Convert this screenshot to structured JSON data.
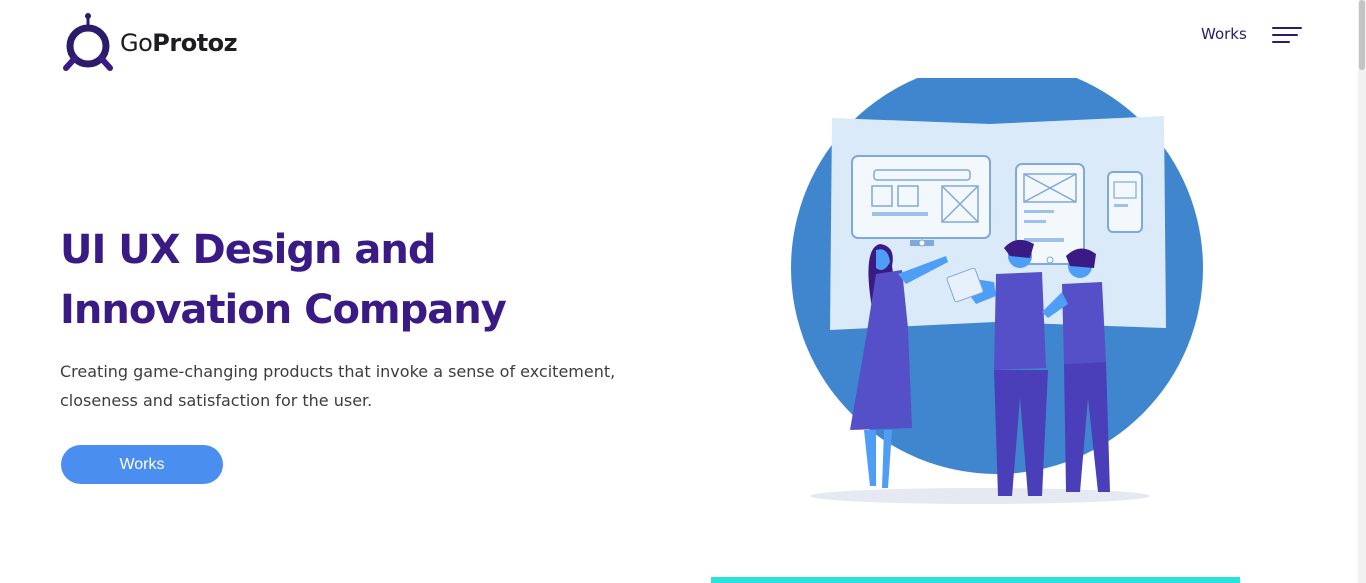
{
  "brand": {
    "prefix": "Go",
    "name": "Protoz"
  },
  "nav": {
    "works_label": "Works"
  },
  "hero": {
    "title_line1": "UI UX Design and",
    "title_line2": "Innovation Company",
    "subtitle": "Creating game-changing products that invoke a sense of excitement, closeness and satisfaction for the user.",
    "cta_label": "Works"
  },
  "colors": {
    "primary": "#3a1a84",
    "accent": "#4a8ef0",
    "circle": "#3f86cf",
    "teal": "#28e4dd"
  },
  "icons": {
    "menu": "hamburger-menu-icon",
    "logo": "goprotoz-logo-icon"
  }
}
